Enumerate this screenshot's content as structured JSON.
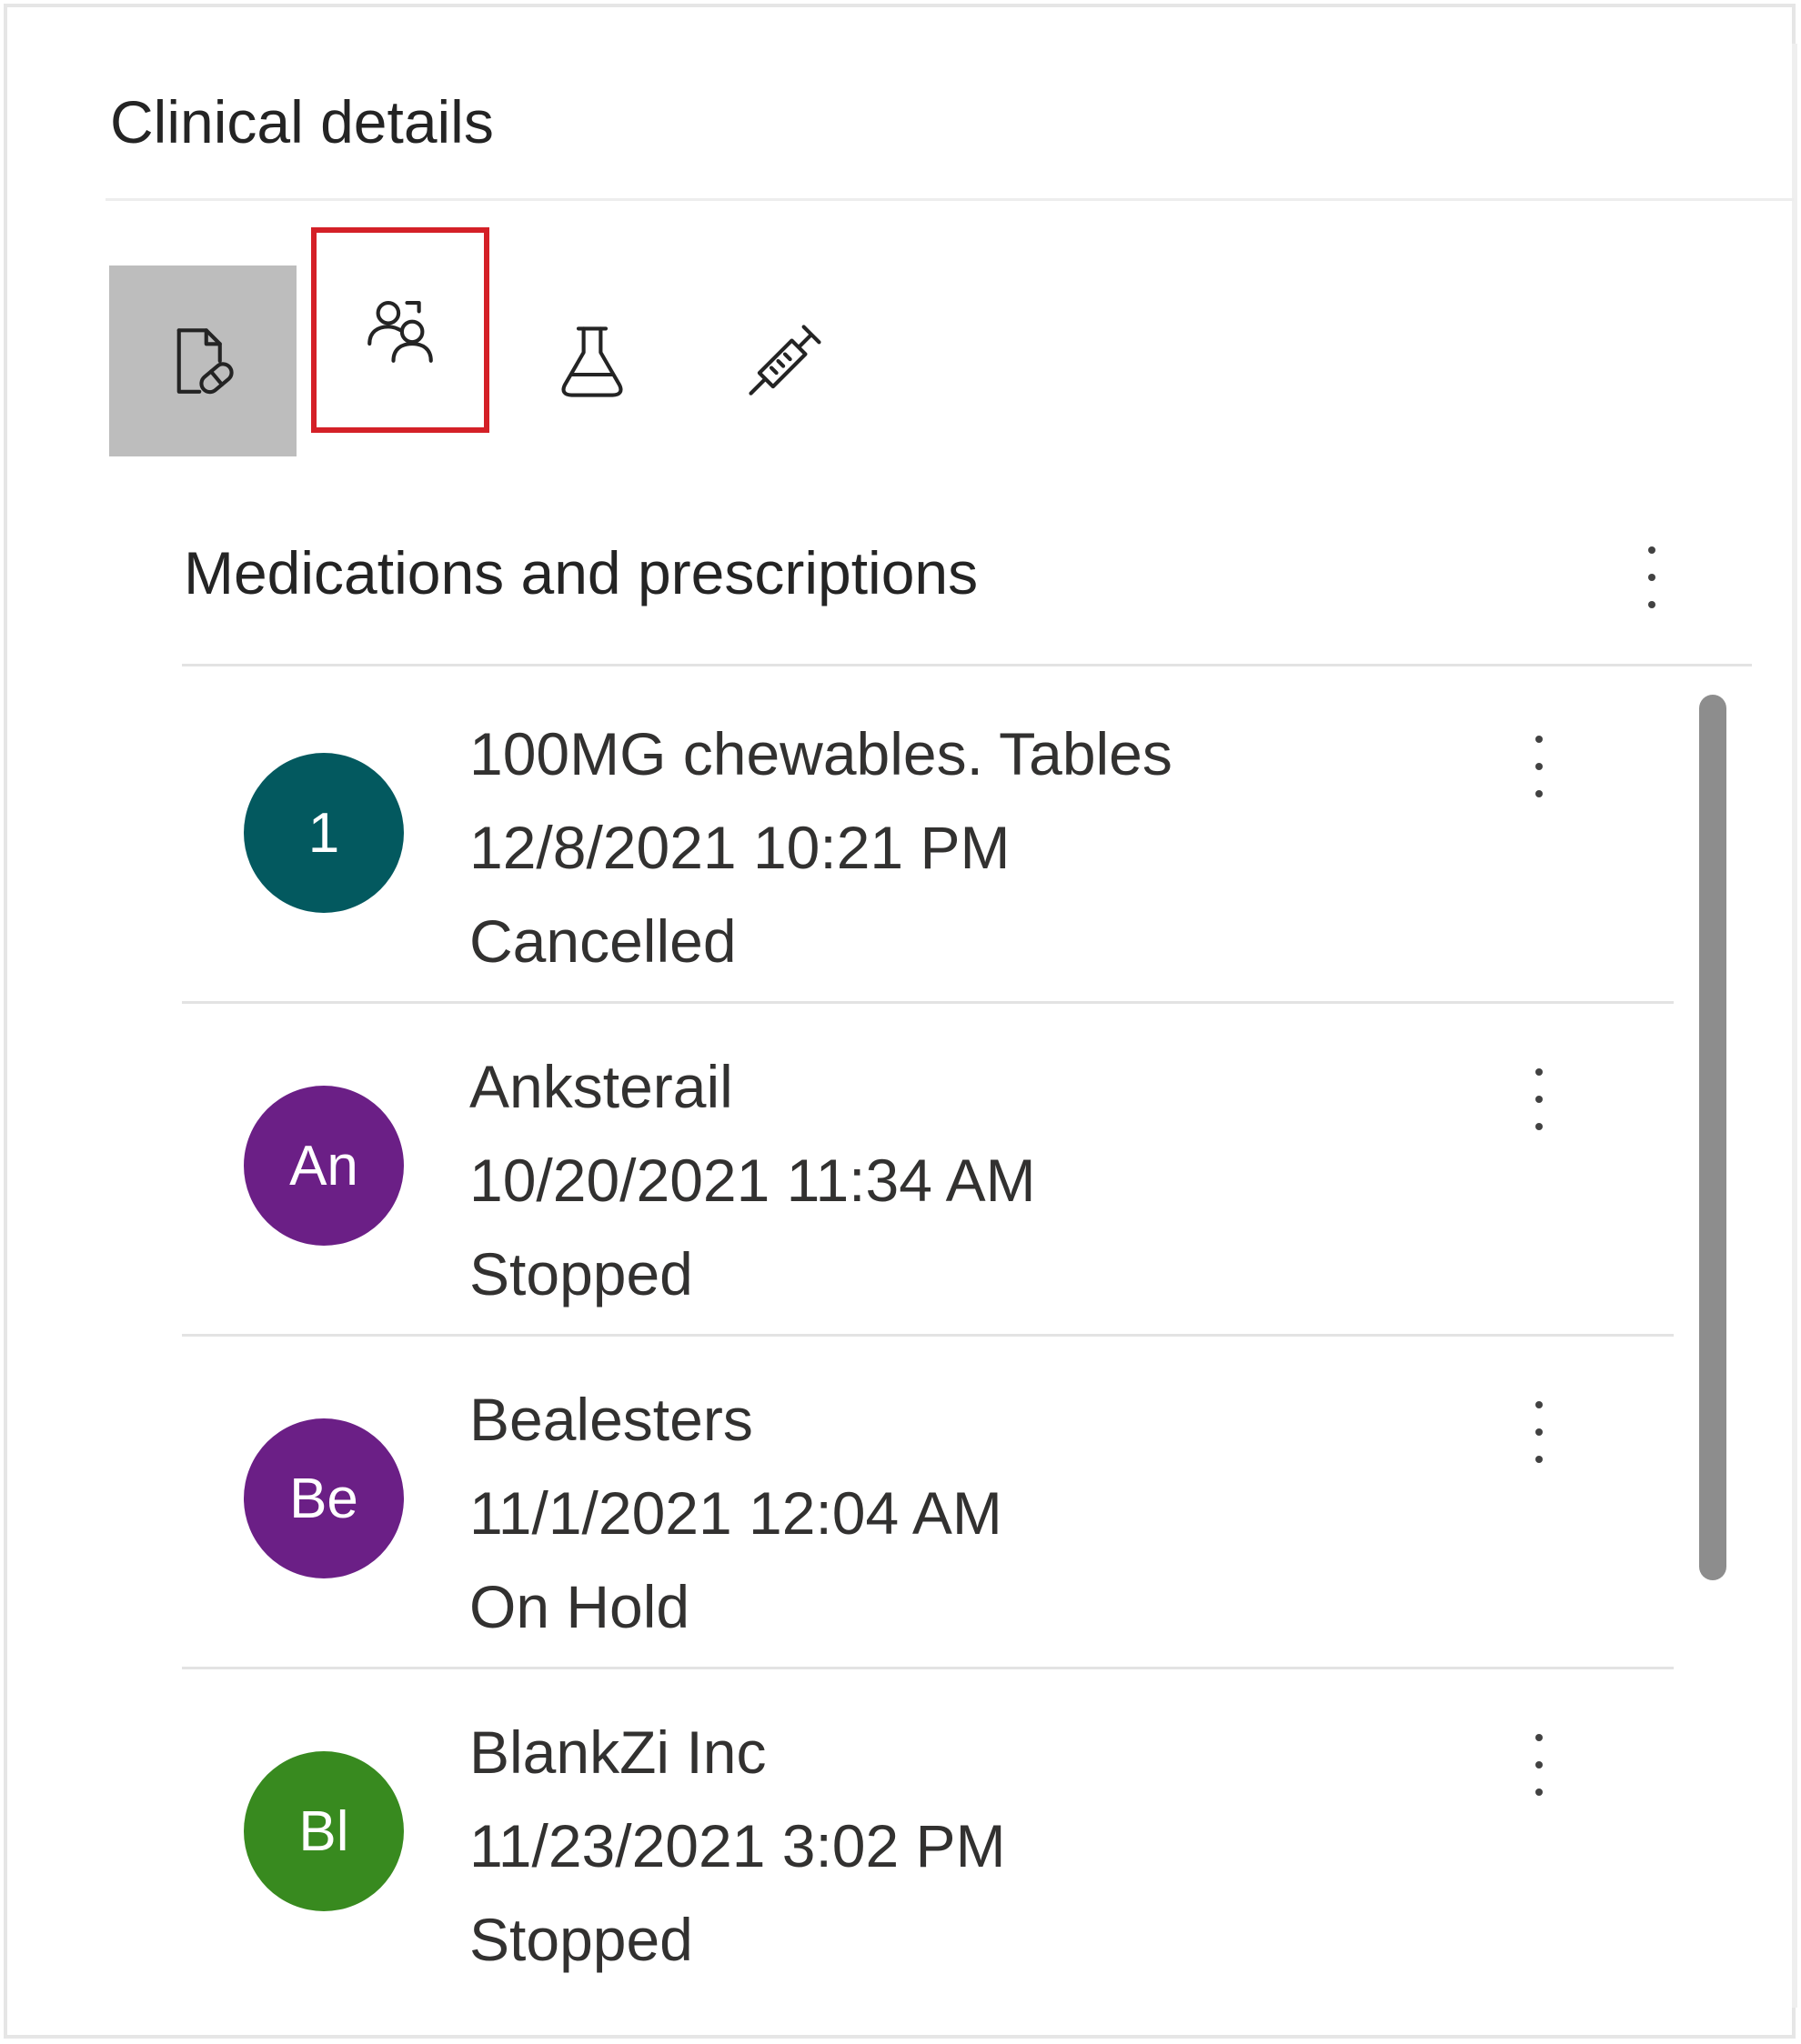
{
  "card": {
    "title": "Clinical details"
  },
  "tabs": [
    {
      "icon": "medication-document-icon",
      "selected": true,
      "highlighted": false
    },
    {
      "icon": "people-icon",
      "selected": false,
      "highlighted": true
    },
    {
      "icon": "lab-flask-icon",
      "selected": false,
      "highlighted": false
    },
    {
      "icon": "syringe-icon",
      "selected": false,
      "highlighted": false
    }
  ],
  "section": {
    "title": "Medications and prescriptions"
  },
  "items": [
    {
      "initials": "1",
      "avatar_color": "#03595f",
      "name": "100MG chewables. Tables",
      "date": "12/8/2021 10:21 PM",
      "status": "Cancelled"
    },
    {
      "initials": "An",
      "avatar_color": "#6b1f86",
      "name": "Anksterail",
      "date": "10/20/2021 11:34 AM",
      "status": "Stopped"
    },
    {
      "initials": "Be",
      "avatar_color": "#6b1f86",
      "name": "Bealesters",
      "date": "11/1/2021 12:04 AM",
      "status": "On Hold"
    },
    {
      "initials": "Bl",
      "avatar_color": "#388a1f",
      "name": "BlankZi Inc",
      "date": "11/23/2021 3:02 PM",
      "status": "Stopped"
    }
  ],
  "colors": {
    "selected_tab_bg": "#bdbdbd",
    "highlight_border": "#d42027",
    "scrollbar": "#8d8d8d"
  }
}
